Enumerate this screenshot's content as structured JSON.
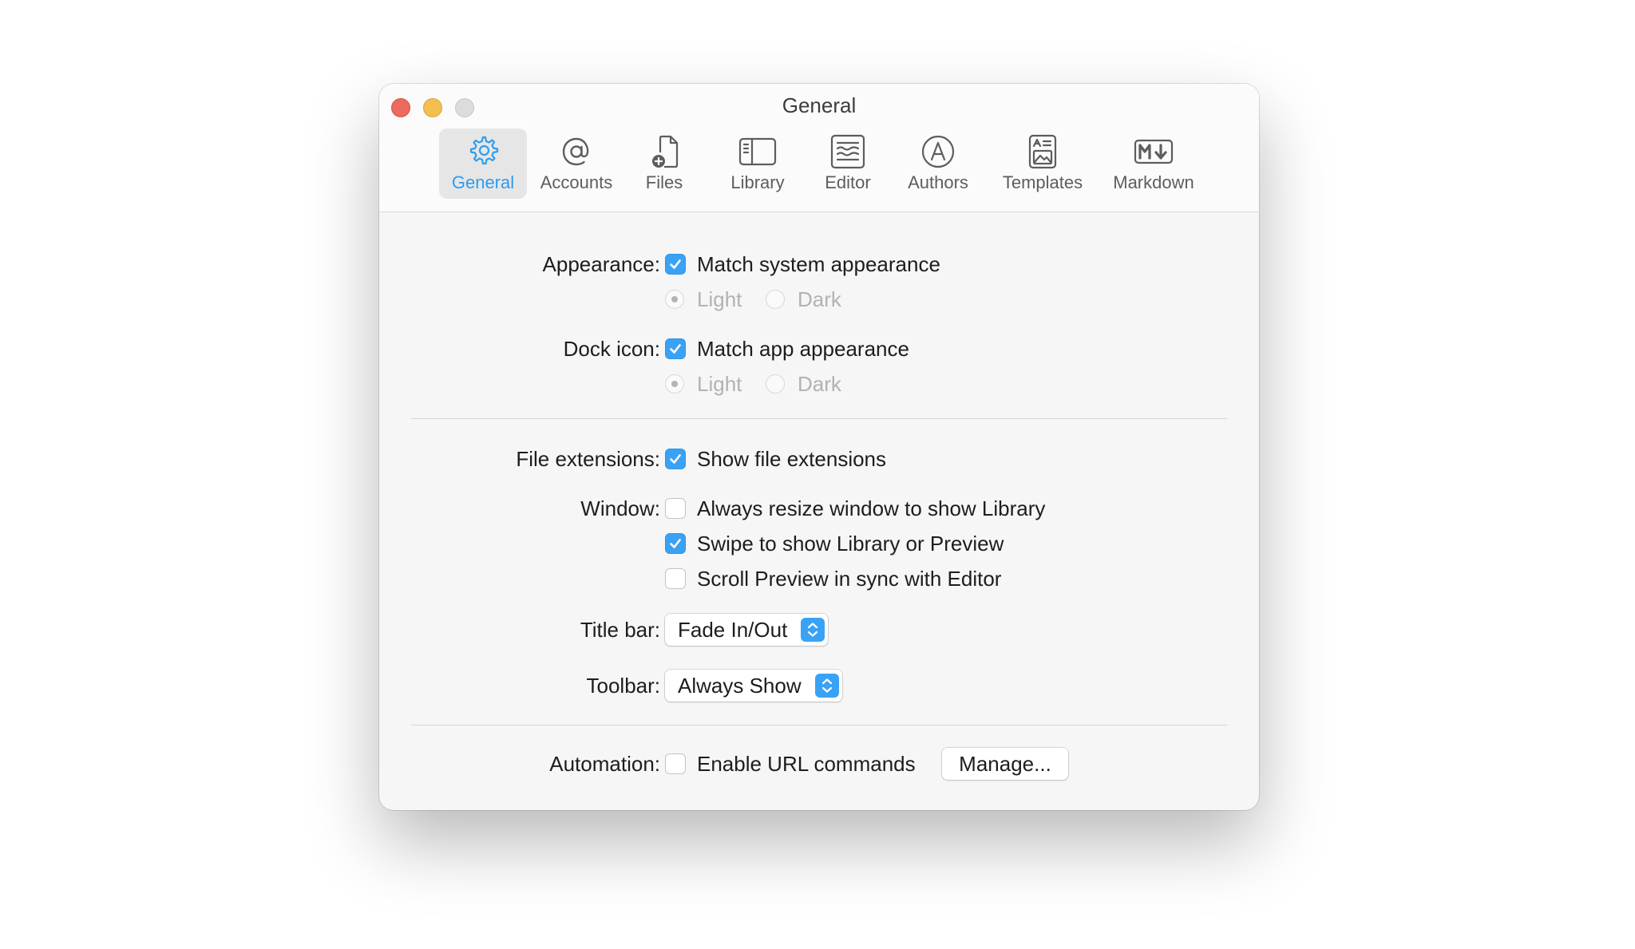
{
  "window": {
    "title": "General"
  },
  "tabs": [
    {
      "label": "General",
      "icon": "gear-icon",
      "selected": true
    },
    {
      "label": "Accounts",
      "icon": "at-sign-icon",
      "selected": false
    },
    {
      "label": "Files",
      "icon": "file-add-icon",
      "selected": false
    },
    {
      "label": "Library",
      "icon": "sidebar-icon",
      "selected": false
    },
    {
      "label": "Editor",
      "icon": "document-lines-icon",
      "selected": false
    },
    {
      "label": "Authors",
      "icon": "author-circle-icon",
      "selected": false
    },
    {
      "label": "Templates",
      "icon": "template-icon",
      "selected": false
    },
    {
      "label": "Markdown",
      "icon": "markdown-icon",
      "selected": false
    }
  ],
  "appearance": {
    "label": "Appearance:",
    "checkbox_label": "Match system appearance",
    "checked": true,
    "light_label": "Light",
    "dark_label": "Dark",
    "selected": "Light"
  },
  "dock_icon": {
    "label": "Dock icon:",
    "checkbox_label": "Match app appearance",
    "checked": true,
    "light_label": "Light",
    "dark_label": "Dark",
    "selected": "Light"
  },
  "file_extensions": {
    "label": "File extensions:",
    "checkbox_label": "Show file extensions",
    "checked": true
  },
  "window_options": {
    "label": "Window:",
    "options": [
      {
        "label": "Always resize window to show Library",
        "checked": false
      },
      {
        "label": "Swipe to show Library or Preview",
        "checked": true
      },
      {
        "label": "Scroll Preview in sync with Editor",
        "checked": false
      }
    ]
  },
  "title_bar": {
    "label": "Title bar:",
    "value": "Fade In/Out"
  },
  "toolbar": {
    "label": "Toolbar:",
    "value": "Always Show"
  },
  "automation": {
    "label": "Automation:",
    "checkbox_label": "Enable URL commands",
    "checked": false,
    "manage_button": "Manage..."
  },
  "colors": {
    "accent": "#3aa2f5",
    "close": "#ed6a5e",
    "minimize": "#f5bf4f",
    "zoom": "#dcdcdc"
  }
}
